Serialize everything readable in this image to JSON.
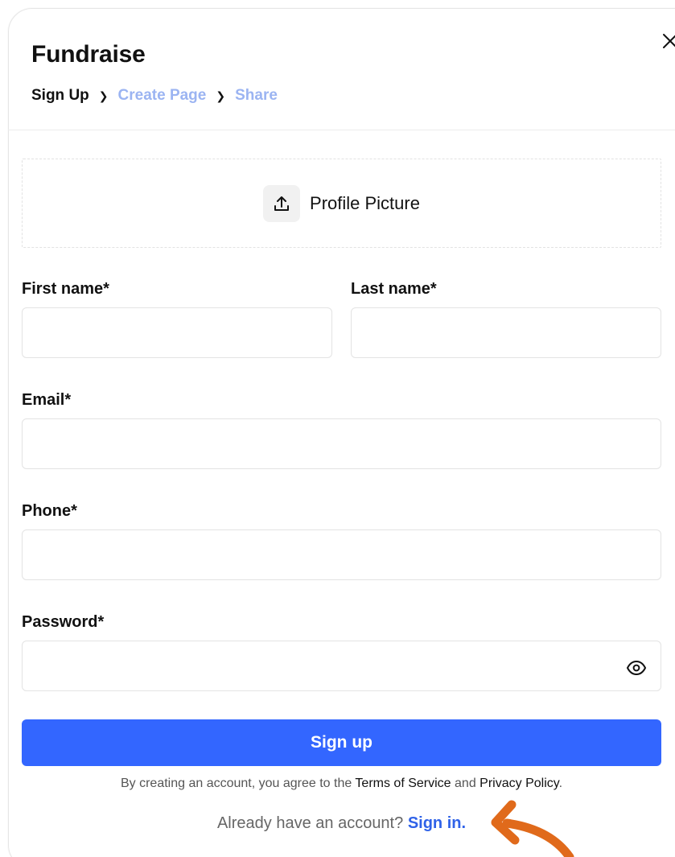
{
  "modal": {
    "title": "Fundraise",
    "close_icon": "close-icon"
  },
  "steps": [
    {
      "label": "Sign Up",
      "state": "current"
    },
    {
      "label": "Create Page",
      "state": "upcoming"
    },
    {
      "label": "Share",
      "state": "upcoming"
    }
  ],
  "upload": {
    "icon": "upload-icon",
    "label": "Profile Picture"
  },
  "form": {
    "first_name": {
      "label": "First name*",
      "value": "",
      "placeholder": ""
    },
    "last_name": {
      "label": "Last name*",
      "value": "",
      "placeholder": ""
    },
    "email": {
      "label": "Email*",
      "value": "",
      "placeholder": ""
    },
    "phone": {
      "label": "Phone*",
      "value": "",
      "placeholder": ""
    },
    "password": {
      "label": "Password*",
      "value": "",
      "placeholder": "",
      "toggle_icon": "eye-icon"
    }
  },
  "submit_label": "Sign up",
  "terms": {
    "prefix": "By creating an account, you agree to the",
    "terms_link": "Terms of Service",
    "and": "and",
    "privacy_link": "Privacy Policy",
    "suffix": "."
  },
  "signin": {
    "prompt": "Already have an account?",
    "link": "Sign in."
  },
  "annotation": {
    "icon": "curved-arrow-icon",
    "color": "#e06a1b"
  },
  "colors": {
    "primary": "#3366ff",
    "step_upcoming": "#9bb4f2",
    "signin_link": "#2f62e8"
  }
}
